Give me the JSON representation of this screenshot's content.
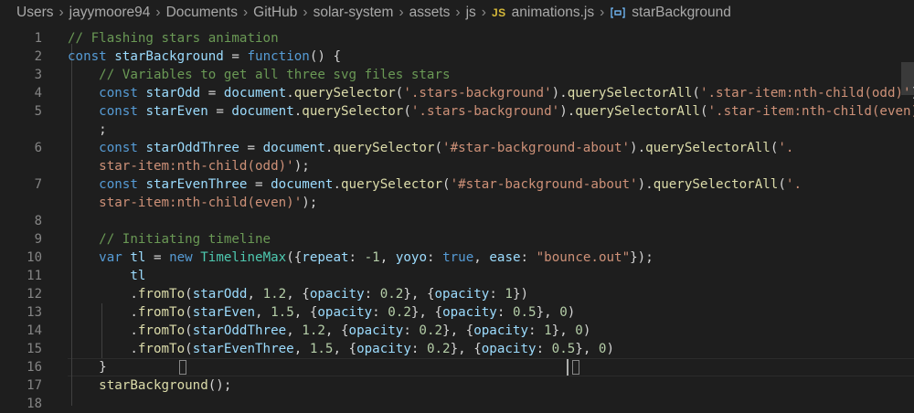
{
  "breadcrumb": {
    "items": [
      "Users",
      "jayymoore94",
      "Documents",
      "GitHub",
      "solar-system",
      "assets",
      "js"
    ],
    "file_badge": "JS",
    "file": "animations.js",
    "symbol": "starBackground"
  },
  "editor": {
    "line_numbers": [
      "1",
      "2",
      "3",
      "4",
      "5",
      "",
      "6",
      "",
      "7",
      "",
      "8",
      "9",
      "10",
      "11",
      "12",
      "13",
      "14",
      "15",
      "16",
      "17",
      "18"
    ],
    "lines": {
      "l1": [
        "// Flashing stars animation"
      ],
      "l2": [
        "const",
        " ",
        "starBackground",
        " = ",
        "function",
        "() {"
      ],
      "l3": [
        "// Variables to get all three svg files stars"
      ],
      "l4": [
        "const",
        " ",
        "starOdd",
        " = ",
        "document",
        ".",
        "querySelector",
        "(",
        "'.stars-background'",
        ").",
        "querySelectorAll",
        "(",
        "'.star-item:nth-child(odd)'",
        ");"
      ],
      "l5": [
        "const",
        " ",
        "starEven",
        " = ",
        "document",
        ".",
        "querySelector",
        "(",
        "'.stars-background'",
        ").",
        "querySelectorAll",
        "(",
        "'.star-item:nth-child(even)'",
        ")"
      ],
      "l5b": [
        ";"
      ],
      "l6": [
        "const",
        " ",
        "starOddThree",
        " = ",
        "document",
        ".",
        "querySelector",
        "(",
        "'#star-background-about'",
        ").",
        "querySelectorAll",
        "(",
        "'."
      ],
      "l6b": [
        "star-item:nth-child(odd)'",
        ");"
      ],
      "l7": [
        "const",
        " ",
        "starEvenThree",
        " = ",
        "document",
        ".",
        "querySelector",
        "(",
        "'#star-background-about'",
        ").",
        "querySelectorAll",
        "(",
        "'."
      ],
      "l7b": [
        "star-item:nth-child(even)'",
        ");"
      ],
      "l9": [
        "// Initiating timeline"
      ],
      "l10": [
        "var",
        " ",
        "tl",
        " = ",
        "new",
        " ",
        "TimelineMax",
        "({",
        "repeat",
        ": ",
        "-1",
        ", ",
        "yoyo",
        ": ",
        "true",
        ", ",
        "ease",
        ": ",
        "\"bounce.out\"",
        "});"
      ],
      "l11": [
        "tl"
      ],
      "l12": [
        ".",
        "fromTo",
        "(",
        "starOdd",
        ", ",
        "1.2",
        ", {",
        "opacity",
        ": ",
        "0.2",
        "}, {",
        "opacity",
        ": ",
        "1",
        "})"
      ],
      "l13": [
        ".",
        "fromTo",
        "(",
        "starEven",
        ", ",
        "1.5",
        ", {",
        "opacity",
        ": ",
        "0.2",
        "}, {",
        "opacity",
        ": ",
        "0.5",
        "}, ",
        "0",
        ")"
      ],
      "l14": [
        ".",
        "fromTo",
        "(",
        "starOddThree",
        ", ",
        "1.2",
        ", {",
        "opacity",
        ": ",
        "0.2",
        "}, {",
        "opacity",
        ": ",
        "1",
        "}, ",
        "0",
        ")"
      ],
      "l15": [
        ".",
        "fromTo",
        "(",
        "starEvenThree",
        ", ",
        "1.5",
        ", {",
        "opacity",
        ": ",
        "0.2",
        "}, {",
        "opacity",
        ": ",
        "0.5",
        "},",
        " ",
        "0",
        ")"
      ],
      "l16": [
        "}"
      ],
      "l17": [
        "starBackground",
        "();"
      ]
    }
  },
  "colors": {
    "background": "#1e1e1e",
    "comment": "#6a9955",
    "keyword": "#569cd6",
    "variable": "#9cdcfe",
    "function": "#dcdcaa",
    "string": "#ce9178",
    "number": "#b5cea8",
    "class": "#4ec9b0"
  }
}
